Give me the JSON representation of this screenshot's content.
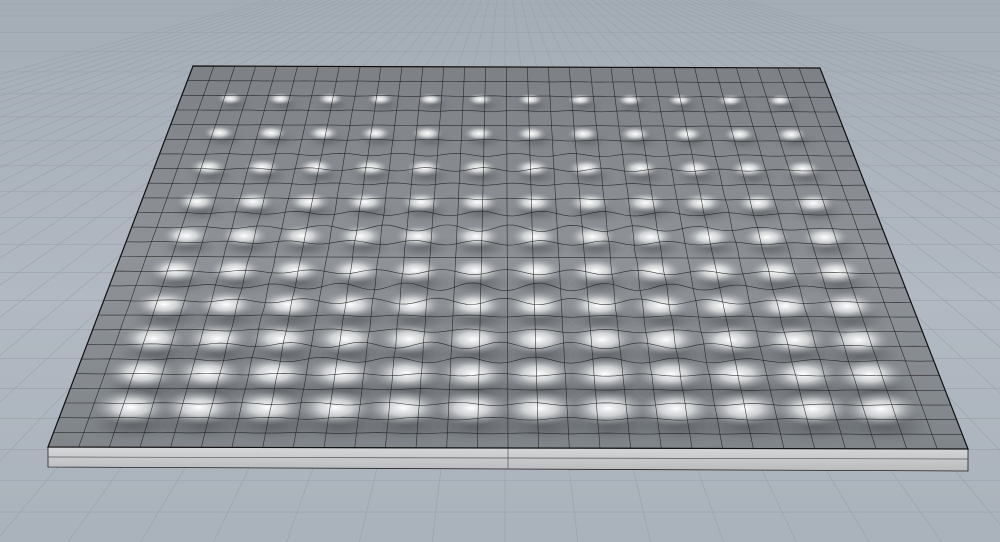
{
  "viewport": {
    "view": "perspective",
    "background_color": "#aab1ba",
    "construction_grid": {
      "visible": true,
      "line_color": "#99a1ab"
    }
  },
  "model": {
    "object": "wavy-surface-slab",
    "surface_color": "#8a8e93",
    "highlight_color": "#ffffff",
    "edge_color": "#1a1a1a",
    "slab_side_color": "#c9cbcd",
    "isocurve_grid": {
      "u_count": 30,
      "v_count": 26
    },
    "bump_rows": 10,
    "bump_columns": 12
  }
}
